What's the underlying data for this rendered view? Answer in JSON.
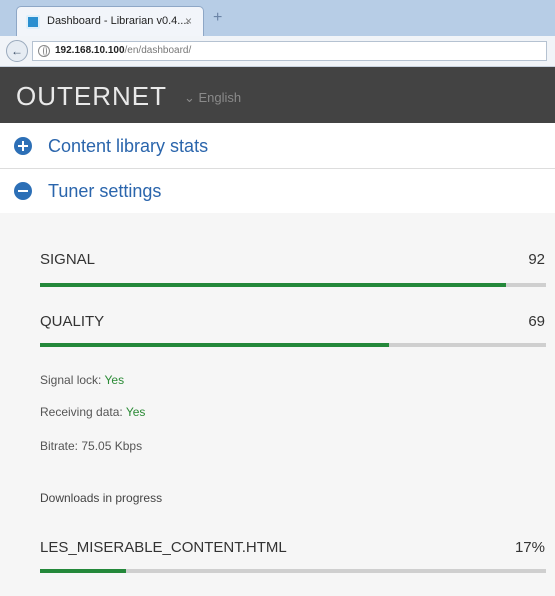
{
  "browser": {
    "tab_title": "Dashboard - Librarian v0.4....",
    "tab_close": "×",
    "new_tab": "+",
    "back": "←",
    "url_host": "192.168.10.100",
    "url_path": "/en/dashboard/"
  },
  "header": {
    "logo": "OUTERNET",
    "language": "⌄ English"
  },
  "sections": {
    "content_stats": "Content library stats",
    "tuner_settings": "Tuner settings"
  },
  "tuner": {
    "signal": {
      "label": "SIGNAL",
      "value": "92",
      "level": 0.92
    },
    "quality": {
      "label": "QUALITY",
      "value": "69",
      "level": 0.69
    },
    "signal_lock": {
      "label": "Signal lock:",
      "value": "Yes"
    },
    "receiving_data": {
      "label": "Receiving data:",
      "value": "Yes"
    },
    "bitrate": "Bitrate: 75.05 Kbps"
  },
  "downloads": {
    "heading": "Downloads in progress",
    "items": [
      {
        "name": "LES_MISERABLE_CONTENT.HTML",
        "percent_text": "17%",
        "progress": 0.17
      }
    ]
  },
  "colors": {
    "accent": "#2a65ac",
    "progress_fill": "#24883a",
    "header_bg": "#434343"
  }
}
